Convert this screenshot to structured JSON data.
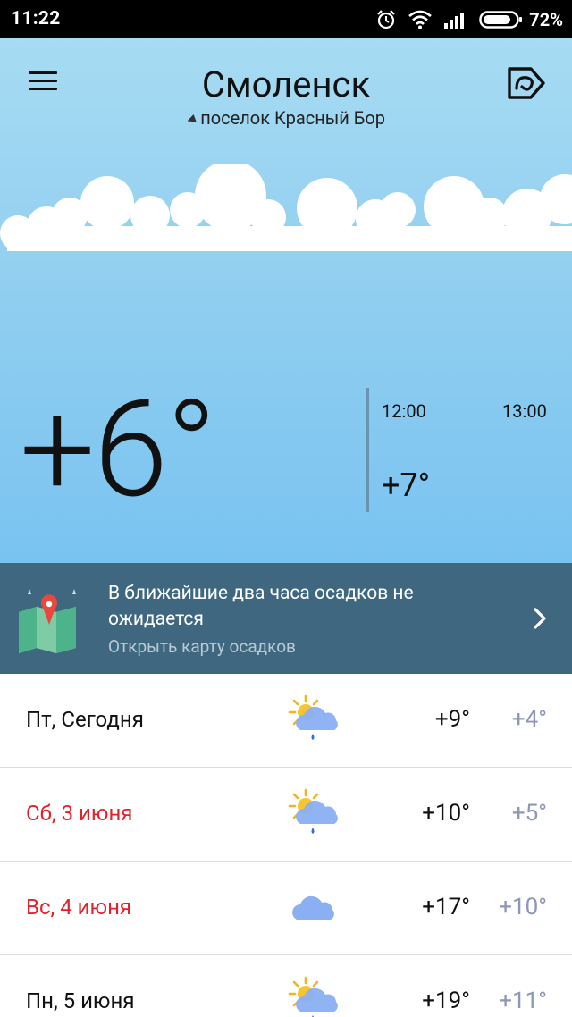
{
  "status_bar": {
    "time": "11:22",
    "battery": "72%",
    "icons": [
      "alarm-icon",
      "wifi-icon",
      "signal-icon",
      "battery-icon"
    ]
  },
  "header": {
    "city": "Смоленск",
    "location": "поселок Красный Бор",
    "menu_icon": "hamburger-menu-icon",
    "brand_icon": "yandex-weather-brand-icon"
  },
  "current": {
    "temperature": "+6°"
  },
  "hourly": [
    {
      "time": "12:00",
      "temp": "+7°"
    },
    {
      "time": "13:00",
      "temp": ""
    }
  ],
  "precip": {
    "message": "В ближайшие два часа осадков не ожидается",
    "link": "Открыть карту осадков",
    "icon": "precipitation-map-icon"
  },
  "forecast": [
    {
      "day": "Пт, Сегодня",
      "weekend": false,
      "icon": "partly-cloudy-rain-icon",
      "max": "+9°",
      "min": "+4°"
    },
    {
      "day": "Сб, 3 июня",
      "weekend": true,
      "icon": "partly-cloudy-rain-icon",
      "max": "+10°",
      "min": "+5°"
    },
    {
      "day": "Вс, 4 июня",
      "weekend": true,
      "icon": "cloud-icon",
      "max": "+17°",
      "min": "+10°"
    },
    {
      "day": "Пн, 5 июня",
      "weekend": false,
      "icon": "partly-cloudy-rain-icon",
      "max": "+19°",
      "min": "+11°"
    }
  ],
  "colors": {
    "sky_top": "#a7dbf3",
    "sky_bottom": "#79c3f1",
    "banner": "#3f6880",
    "weekend": "#e3212a",
    "min_temp": "#8e97b8"
  }
}
